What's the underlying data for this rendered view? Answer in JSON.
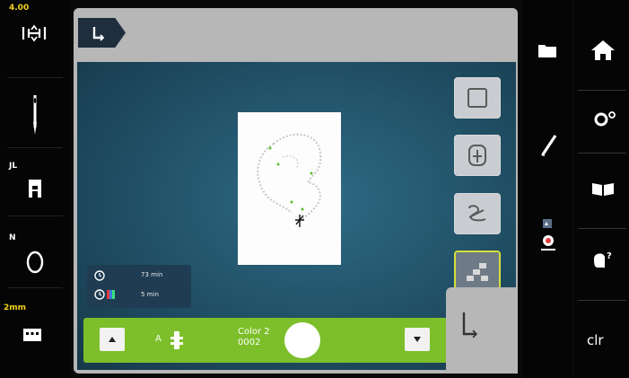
{
  "status": {
    "speed_label": "4.00",
    "foot_label": "JL",
    "needle_label": "N",
    "width_label": "2mm"
  },
  "info": {
    "time_row1": "73 min",
    "time_row2": "5 min"
  },
  "color_bar": {
    "color_label": "Color 2",
    "color_code": "0002",
    "label_a": "A"
  },
  "nav": {
    "clr_label": "clr"
  },
  "colors": {
    "accent_green": "#7cbf2a",
    "canvas_teal": "#24576e",
    "active_border": "#d6e03a"
  },
  "icons": [
    "back-arrow-icon",
    "thread-tension-icon",
    "needle-icon",
    "presser-foot-icon",
    "circle-icon",
    "grid-icon",
    "hoop-frame-icon",
    "move-design-icon",
    "edit-design-icon",
    "color-sequence-icon",
    "home-icon",
    "settings-icon",
    "book-icon",
    "help-icon",
    "pencil-icon",
    "folder-icon",
    "embroidery-module-icon"
  ]
}
